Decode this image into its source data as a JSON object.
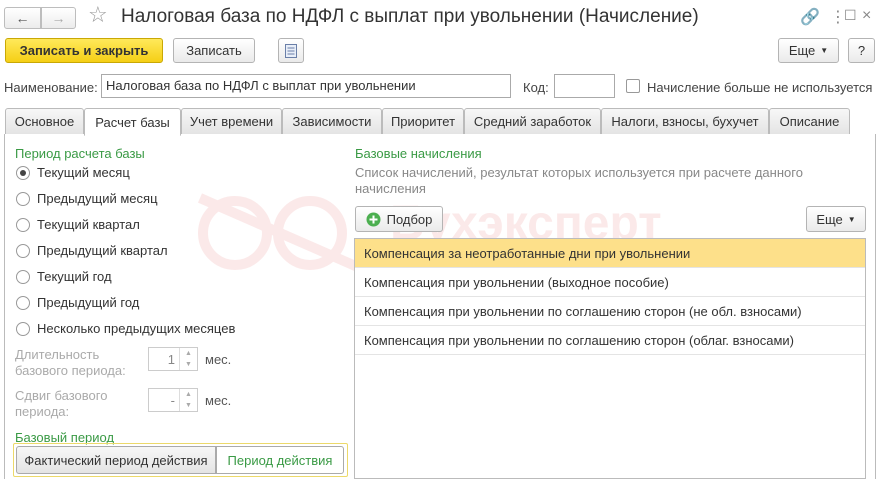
{
  "window": {
    "title": "Налоговая база по НДФЛ с выплат при увольнении (Начисление)",
    "back_icon": "arrow-left-icon",
    "forward_icon": "arrow-right-icon",
    "favorite_icon": "star-icon",
    "link_icon": "link-icon",
    "menu_icon": "more-vertical-icon",
    "maximize_icon": "maximize-icon",
    "close_icon": "close-icon"
  },
  "toolbar": {
    "save_close_label": "Записать и закрыть",
    "save_label": "Записать",
    "more_label": "Еще",
    "help_label": "?"
  },
  "fields": {
    "name_label": "Наименование:",
    "name_value": "Налоговая база по НДФЛ с выплат при увольнении",
    "code_label": "Код:",
    "code_value": "",
    "unused_label": "Начисление больше не используется"
  },
  "tabs": [
    {
      "label": "Основное"
    },
    {
      "label": "Расчет базы"
    },
    {
      "label": "Учет времени"
    },
    {
      "label": "Зависимости"
    },
    {
      "label": "Приоритет"
    },
    {
      "label": "Средний заработок"
    },
    {
      "label": "Налоги, взносы, бухучет"
    },
    {
      "label": "Описание"
    }
  ],
  "active_tab": "Расчет базы",
  "period": {
    "title": "Период расчета базы",
    "options": [
      {
        "label": "Текущий месяц",
        "checked": true
      },
      {
        "label": "Предыдущий месяц",
        "checked": false
      },
      {
        "label": "Текущий квартал",
        "checked": false
      },
      {
        "label": "Предыдущий квартал",
        "checked": false
      },
      {
        "label": "Текущий год",
        "checked": false
      },
      {
        "label": "Предыдущий год",
        "checked": false
      },
      {
        "label": "Несколько предыдущих месяцев",
        "checked": false
      }
    ],
    "duration_label_1": "Длительность",
    "duration_label_2": "базового периода:",
    "duration_value": "1",
    "duration_unit": "мес.",
    "shift_label_1": "Сдвиг базового",
    "shift_label_2": "периода:",
    "shift_value": "-",
    "shift_unit": "мес."
  },
  "base_period": {
    "title": "Базовый период",
    "option_actual": "Фактический период действия",
    "option_period": "Период действия"
  },
  "base_accruals": {
    "title": "Базовые начисления",
    "description": "Список начислений, результат которых используется при расчете данного начисления",
    "pick_label": "Подбор",
    "pick_icon": "plus-circle-icon",
    "more_label": "Еще",
    "items": [
      "Компенсация за неотработанные дни при увольнении",
      "Компенсация при увольнении (выходное пособие)",
      "Компенсация при увольнении по соглашению сторон (не обл. взносами)",
      "Компенсация при увольнении по соглашению сторон (облаг. взносами)"
    ]
  },
  "watermark": {
    "text": "Бухэксперт"
  },
  "colors": {
    "accent_yellow": "#f5cf15",
    "group_green": "#3a9a45",
    "selected_row": "#fde08a"
  }
}
